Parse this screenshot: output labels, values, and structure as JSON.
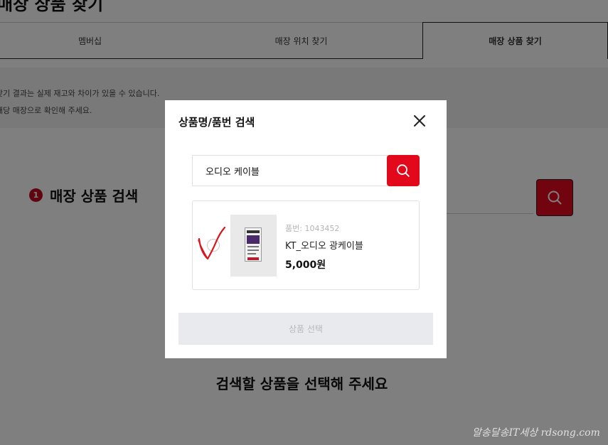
{
  "page": {
    "title": "매장 상품 찾기",
    "tabs": [
      {
        "label": "멤버십"
      },
      {
        "label": "매장 위치 찾기"
      },
      {
        "label": "매장 상품 찾기"
      }
    ],
    "notice": [
      "찾기 결과는 실제 재고와 차이가 있을 수 있습니다.",
      "해당 매장으로 확인해 주세요."
    ],
    "section": {
      "number": "1",
      "title": "매장 상품 검색"
    },
    "hint": "검색할 상품을 선택해 주세요"
  },
  "modal": {
    "title": "상품명/품번 검색",
    "close_icon": "close-icon",
    "search": {
      "value": "오디오 케이블",
      "icon": "search-icon"
    },
    "result": {
      "code": "품번: 1043452",
      "name": "KT_오디오 광케이블",
      "price": "5,000원"
    },
    "select_label": "상품 선택"
  },
  "watermark": "알송달송IT세상 rdsong.com",
  "colors": {
    "accent": "#e3091d",
    "badge": "#c00a1e",
    "annotation": "#d8141c",
    "overlay": "rgba(0,0,0,0.5)",
    "button_disabled_bg": "#e9eaed",
    "button_disabled_text": "#b8b8bc"
  }
}
